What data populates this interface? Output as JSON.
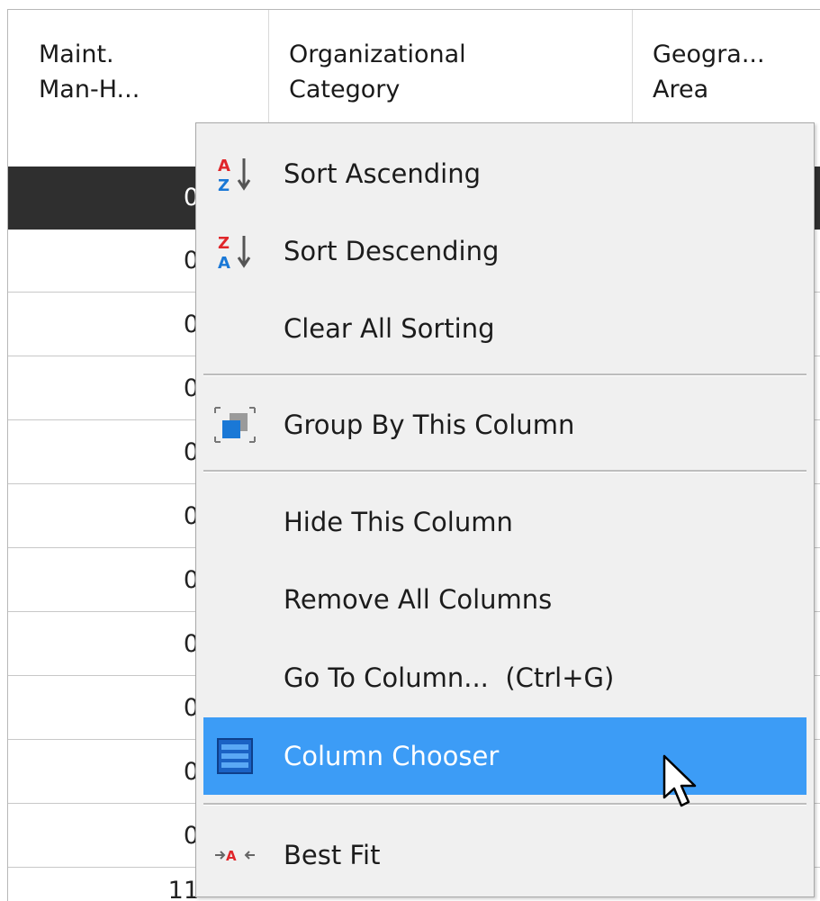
{
  "grid": {
    "columns": [
      {
        "line1": "Maint.",
        "line2": "Man-H..."
      },
      {
        "line1": "Organizational",
        "line2": "Category"
      },
      {
        "line1": "Geogra...",
        "line2": "Area"
      }
    ],
    "rows": [
      "0",
      "0",
      "0",
      "0",
      "0",
      "0",
      "0",
      "0",
      "0",
      "0",
      "0"
    ],
    "partial_value": "11"
  },
  "context_menu": {
    "sort_ascending": "Sort Ascending",
    "sort_descending": "Sort Descending",
    "clear_all_sorting": "Clear All Sorting",
    "group_by_column": "Group By This Column",
    "hide_column": "Hide This Column",
    "remove_all_columns": "Remove All Columns",
    "go_to_column": "Go To Column...  (Ctrl+G)",
    "column_chooser": "Column Chooser",
    "best_fit": "Best Fit"
  },
  "colors": {
    "highlight": "#3c9cf6",
    "selected_row": "#2f2f2f",
    "menu_bg": "#f0f0f0"
  }
}
